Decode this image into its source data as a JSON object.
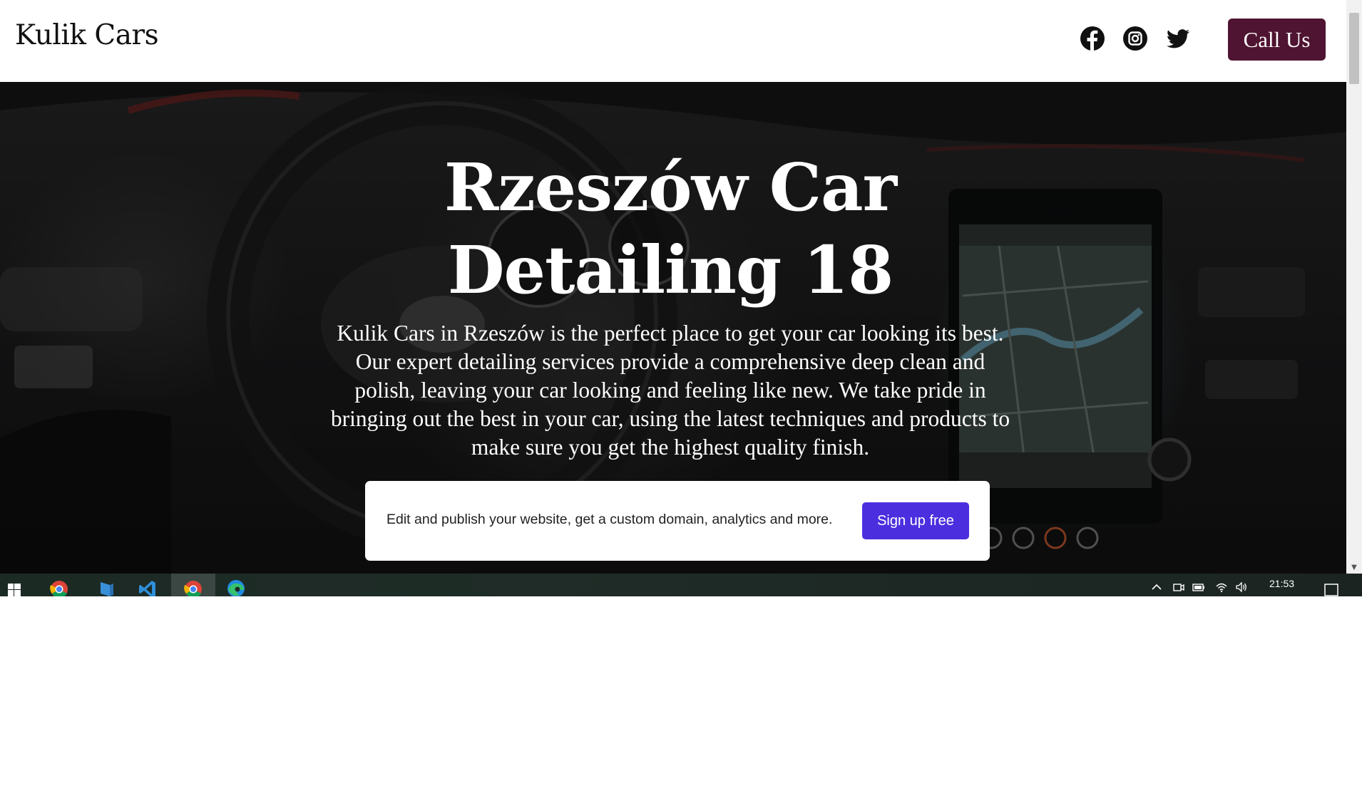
{
  "header": {
    "brand": "Kulik Cars",
    "social_icons": [
      "facebook-icon",
      "instagram-icon",
      "twitter-icon"
    ],
    "call_label": "Call Us",
    "call_color": "#4f1431"
  },
  "hero": {
    "title": "Rzeszów Car Detailing 18",
    "description": "Kulik Cars in Rzeszów is the perfect place to get your car looking its best. Our expert detailing services provide a comprehensive deep clean and polish, leaving your car looking and feeling like new. We take pride in bringing out the best in your car, using the latest techniques and products to make sure you get the highest quality finish."
  },
  "promo": {
    "text": "Edit and publish your website, get a custom domain, analytics and more.",
    "button_label": "Sign up free",
    "button_color": "#4b2fdf"
  },
  "taskbar": {
    "apps": [
      "windows-start-icon",
      "chrome-icon",
      "app-icon",
      "vscode-icon",
      "chrome-icon",
      "edge-icon"
    ],
    "tray": [
      "chevron-up-icon",
      "meet-icon",
      "battery-icon",
      "wifi-icon",
      "volume-icon",
      "notification-icon"
    ],
    "clock": "21:53"
  }
}
